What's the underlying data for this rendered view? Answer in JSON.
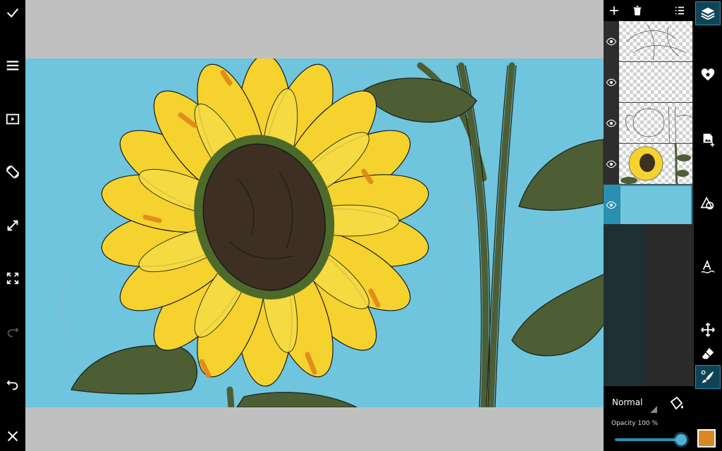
{
  "left_toolbar": {
    "items": [
      {
        "name": "confirm-icon"
      },
      {
        "name": "menu-icon"
      },
      {
        "name": "play-icon"
      },
      {
        "name": "rotate-icon"
      },
      {
        "name": "resize-icon"
      },
      {
        "name": "fullscreen-icon"
      },
      {
        "name": "redo-icon"
      },
      {
        "name": "undo-icon"
      },
      {
        "name": "close-icon"
      }
    ]
  },
  "layers_panel": {
    "toolbar": [
      "add-layer-icon",
      "delete-layer-icon",
      "layer-list-icon"
    ],
    "layers": [
      {
        "type": "sketch-transparent",
        "visible": true
      },
      {
        "type": "empty-transparent",
        "visible": true
      },
      {
        "type": "sketch-transparent",
        "visible": true
      },
      {
        "type": "sunflower-color",
        "visible": true
      },
      {
        "type": "background-fill",
        "visible": true,
        "selected": true
      }
    ],
    "blend_mode": "Normal",
    "opacity_label": "Opacity  100 %",
    "opacity": 1.0
  },
  "right_toolbar": {
    "items": [
      "layers-icon",
      "favorite-sticker-icon",
      "add-image-icon",
      "shapes-icon",
      "text-icon",
      "move-icon",
      "eraser-icon",
      "brush-settings-icon"
    ],
    "current_color": "#d98826"
  },
  "colors": {
    "canvas_bg": "#6fc5de",
    "petal": "#f5d22e",
    "petal_shadow": "#e0861a",
    "center": "#3e2f23",
    "leaf": "#4d5e34",
    "accent": "#2a8fb0"
  }
}
